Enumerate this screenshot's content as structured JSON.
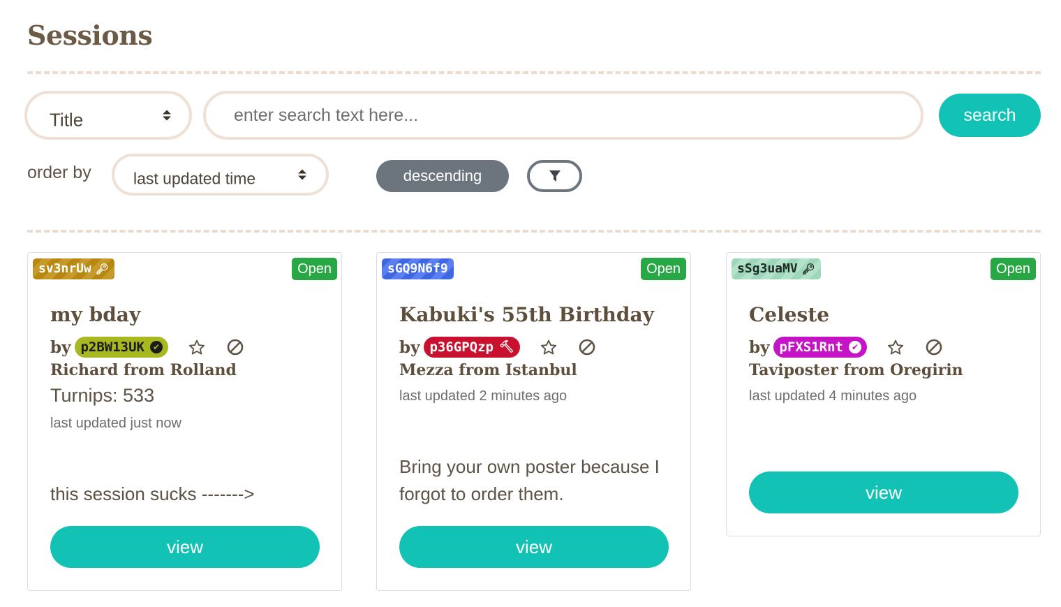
{
  "page": {
    "title": "Sessions"
  },
  "search": {
    "field_select_value": "Title",
    "placeholder": "enter search text here...",
    "button_label": "search"
  },
  "order": {
    "label": "order by",
    "select_value": "last updated time",
    "direction_label": "descending",
    "filter_icon": "filter-icon"
  },
  "colors": {
    "accent": "#12c3b5",
    "open_status": "#28a745",
    "secondary": "#6c757d",
    "dash": "#ecdccf"
  },
  "sessions": [
    {
      "id": "sv3nrUw",
      "id_icon": "key-icon",
      "status": "Open",
      "title": "my bday",
      "by": "by",
      "host": "p2BW13UK",
      "host_badge": "verified-icon",
      "origin": "Richard from Rolland",
      "turnips": "Turnips: 533",
      "updated": "last updated just now",
      "description": "this session sucks ------->",
      "view_label": "view"
    },
    {
      "id": "sGQ9N6f9",
      "status": "Open",
      "title": "Kabuki's 55th Birthday",
      "by": "by",
      "host": "p36GPQzp",
      "host_badge": "hammer-icon",
      "origin": "Mezza from Istanbul",
      "updated": "last updated 2 minutes ago",
      "description": "Bring your own poster because I forgot to order them.",
      "view_label": "view"
    },
    {
      "id": "sSg3uaMV",
      "id_icon": "key-icon",
      "status": "Open",
      "title": "Celeste",
      "by": "by",
      "host": "pFXS1Rnt",
      "host_badge": "verified-icon",
      "origin": "Taviposter from Oregirin",
      "updated": "last updated 4 minutes ago",
      "view_label": "view"
    }
  ]
}
